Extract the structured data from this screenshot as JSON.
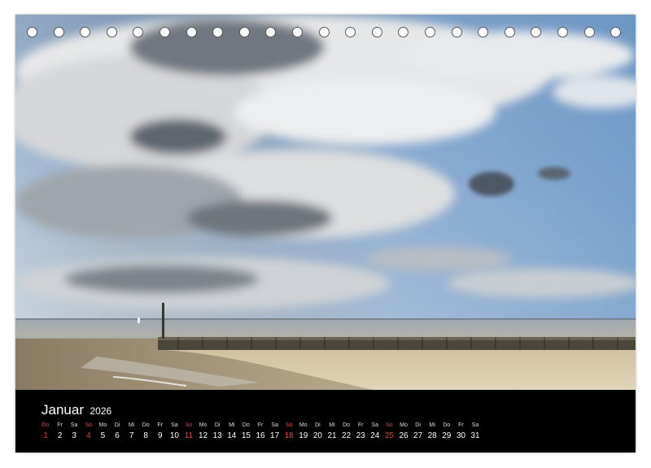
{
  "calendar": {
    "month": "Januar",
    "year": "2026",
    "days": [
      {
        "weekday": "Do",
        "day": "1",
        "sunday": true
      },
      {
        "weekday": "Fr",
        "day": "2",
        "sunday": false
      },
      {
        "weekday": "Sa",
        "day": "3",
        "sunday": false
      },
      {
        "weekday": "So",
        "day": "4",
        "sunday": true
      },
      {
        "weekday": "Mo",
        "day": "5",
        "sunday": false
      },
      {
        "weekday": "Di",
        "day": "6",
        "sunday": false
      },
      {
        "weekday": "Mi",
        "day": "7",
        "sunday": false
      },
      {
        "weekday": "Do",
        "day": "8",
        "sunday": false
      },
      {
        "weekday": "Fr",
        "day": "9",
        "sunday": false
      },
      {
        "weekday": "Sa",
        "day": "10",
        "sunday": false
      },
      {
        "weekday": "So",
        "day": "11",
        "sunday": true
      },
      {
        "weekday": "Mo",
        "day": "12",
        "sunday": false
      },
      {
        "weekday": "Di",
        "day": "13",
        "sunday": false
      },
      {
        "weekday": "Mi",
        "day": "14",
        "sunday": false
      },
      {
        "weekday": "Do",
        "day": "15",
        "sunday": false
      },
      {
        "weekday": "Fr",
        "day": "16",
        "sunday": false
      },
      {
        "weekday": "Sa",
        "day": "17",
        "sunday": false
      },
      {
        "weekday": "So",
        "day": "18",
        "sunday": true
      },
      {
        "weekday": "Mo",
        "day": "19",
        "sunday": false
      },
      {
        "weekday": "Di",
        "day": "20",
        "sunday": false
      },
      {
        "weekday": "Mi",
        "day": "21",
        "sunday": false
      },
      {
        "weekday": "Do",
        "day": "22",
        "sunday": false
      },
      {
        "weekday": "Fr",
        "day": "23",
        "sunday": false
      },
      {
        "weekday": "Sa",
        "day": "24",
        "sunday": false
      },
      {
        "weekday": "So",
        "day": "25",
        "sunday": true
      },
      {
        "weekday": "Mo",
        "day": "26",
        "sunday": false
      },
      {
        "weekday": "Di",
        "day": "27",
        "sunday": false
      },
      {
        "weekday": "Mi",
        "day": "28",
        "sunday": false
      },
      {
        "weekday": "Do",
        "day": "29",
        "sunday": false
      },
      {
        "weekday": "Fr",
        "day": "30",
        "sunday": false
      },
      {
        "weekday": "Sa",
        "day": "31",
        "sunday": false
      }
    ]
  },
  "colors": {
    "sunday_highlight": "#e0443a",
    "strip_background": "#000000",
    "sky_blue": "#7ea3c8",
    "sand": "#d9cbb0"
  }
}
